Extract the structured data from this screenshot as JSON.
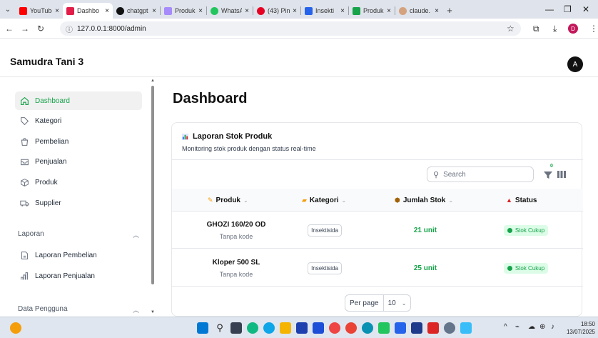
{
  "browser": {
    "tabs": [
      {
        "label": "YouTube",
        "color": "#ff0000"
      },
      {
        "label": "Dashbo",
        "color": "#e11d48",
        "active": true
      },
      {
        "label": "chatgpt",
        "color": "#111111"
      },
      {
        "label": "Produk",
        "color": "#a78bfa"
      },
      {
        "label": "WhatsA",
        "color": "#22c55e"
      },
      {
        "label": "(43) Pin",
        "color": "#e60023"
      },
      {
        "label": "Insekti",
        "color": "#2563eb"
      },
      {
        "label": "Produk",
        "color": "#16a34a"
      },
      {
        "label": "claude.",
        "color": "#d4a27f"
      }
    ],
    "url": "127.0.0.1:8000/admin"
  },
  "app": {
    "brand": "Samudra Tani 3",
    "avatar_initial": "A"
  },
  "sidebar": {
    "items": [
      {
        "label": "Dashboard",
        "icon": "home-icon",
        "active": true
      },
      {
        "label": "Kategori",
        "icon": "tag-icon"
      },
      {
        "label": "Pembelian",
        "icon": "shopping-bag-icon"
      },
      {
        "label": "Penjualan",
        "icon": "inbox-icon"
      },
      {
        "label": "Produk",
        "icon": "cube-icon"
      },
      {
        "label": "Supplier",
        "icon": "truck-icon"
      }
    ],
    "laporan_section": "Laporan",
    "laporan_items": [
      {
        "label": "Laporan Pembelian",
        "icon": "document-icon"
      },
      {
        "label": "Laporan Penjualan",
        "icon": "bar-chart-icon"
      }
    ],
    "data_section": "Data Pengguna"
  },
  "main": {
    "title": "Dashboard",
    "card": {
      "title": "Laporan Stok Produk",
      "subtitle": "Monitoring stok produk dengan status real-time",
      "search_placeholder": "Search",
      "filter_count": "0",
      "columns": [
        {
          "label": "Produk",
          "icon": "pencil-icon"
        },
        {
          "label": "Kategori",
          "icon": "folder-icon"
        },
        {
          "label": "Jumlah Stok",
          "icon": "box-icon"
        },
        {
          "label": "Status",
          "icon": "alert-icon"
        }
      ],
      "rows": [
        {
          "name": "GHOZI 160/20 OD",
          "code": "Tanpa kode",
          "category": "Insektisida",
          "stock": "21 unit",
          "status": "Stok Cukup"
        },
        {
          "name": "Kloper 500 SL",
          "code": "Tanpa kode",
          "category": "Insektisida",
          "stock": "25 unit",
          "status": "Stok Cukup"
        }
      ],
      "per_page_label": "Per page",
      "per_page_value": "10"
    }
  },
  "taskbar": {
    "time": "18:50",
    "date": "13/07/2025"
  }
}
